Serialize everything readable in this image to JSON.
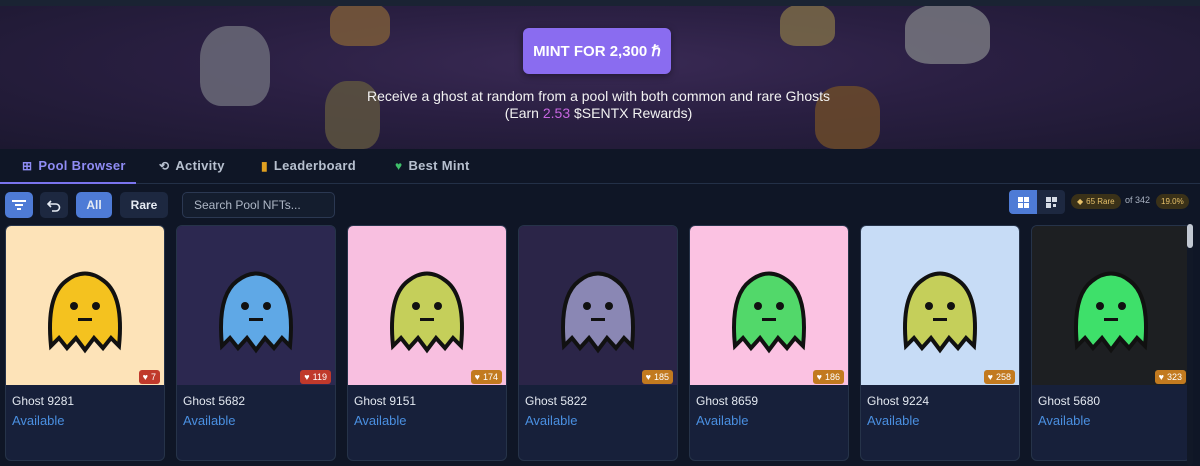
{
  "hero": {
    "mint_label": "MINT FOR 2,300 ℏ",
    "line1": "Receive a ghost at random from a pool with both common and rare Ghosts",
    "line2_prefix": "(Earn ",
    "line2_amount": "2.53",
    "line2_suffix": " $SENTX Rewards)"
  },
  "tabs": [
    {
      "label": "Pool Browser",
      "icon": "grid-icon",
      "active": true
    },
    {
      "label": "Activity",
      "icon": "history-icon"
    },
    {
      "label": "Leaderboard",
      "icon": "bar-chart-icon"
    },
    {
      "label": "Best Mint",
      "icon": "trophy-icon"
    }
  ],
  "toolbar": {
    "filter_icon": "filter-icon",
    "undo_icon": "undo-icon",
    "all_label": "All",
    "rare_label": "Rare",
    "search_placeholder": "Search Pool NFTs...",
    "rare_count": "65 Rare",
    "of_total": "of 342",
    "rare_percent": "19.0%"
  },
  "cards": [
    {
      "name": "Ghost 9281",
      "status": "Available",
      "likes": "7",
      "badge_color": "#c0392b",
      "bg": "#fde3b8",
      "body": "#f4c21f"
    },
    {
      "name": "Ghost 5682",
      "status": "Available",
      "likes": "119",
      "badge_color": "#c0392b",
      "bg": "#2c2850",
      "body": "#5fa8e6"
    },
    {
      "name": "Ghost 9151",
      "status": "Available",
      "likes": "174",
      "badge_color": "#c27a1f",
      "bg": "#f8bfe0",
      "body": "#c5cf5a"
    },
    {
      "name": "Ghost 5822",
      "status": "Available",
      "likes": "185",
      "badge_color": "#c27a1f",
      "bg": "#2b2548",
      "body": "#8a87b4"
    },
    {
      "name": "Ghost 8659",
      "status": "Available",
      "likes": "186",
      "badge_color": "#c27a1f",
      "bg": "#fbc2e2",
      "body": "#52d86a"
    },
    {
      "name": "Ghost 9224",
      "status": "Available",
      "likes": "258",
      "badge_color": "#c27a1f",
      "bg": "#c7dcf6",
      "body": "#c5cf5a"
    },
    {
      "name": "Ghost 5680",
      "status": "Available",
      "likes": "323",
      "badge_color": "#c27a1f",
      "bg": "#1d1f22",
      "body": "#3ee06a"
    }
  ]
}
